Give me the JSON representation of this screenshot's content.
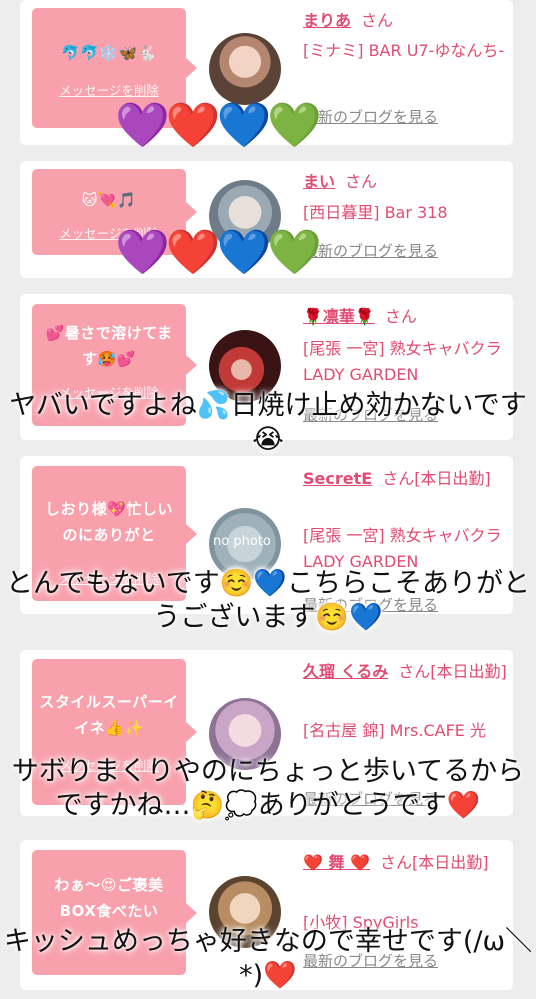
{
  "delete_label": "メッセージを削除",
  "blog_label": "最新のブログを見る",
  "san_label": "さん",
  "cards": [
    {
      "message": "🐬🐬❄️🦋🐇",
      "name": "まりあ",
      "honorific": "さん",
      "shop": "[ミナミ] BAR U7-ゆなんち-"
    },
    {
      "message": "🐱💘🎵",
      "name": "まい",
      "honorific": "さん",
      "shop": "[西日暮里] Bar 318"
    },
    {
      "message": "💕暑さで溶けてます🥵💕",
      "name": "🌹凛華🌹",
      "honorific": "さん",
      "shop": "[尾張 一宮] 熟女キャバクラ LADY GARDEN"
    },
    {
      "message": "しおり様💖忙しいのにありがと",
      "name": "SecretE",
      "honorific": "さん[本日出勤]",
      "shop": "[尾張 一宮] 熟女キャバクラ LADY GARDEN"
    },
    {
      "message": "スタイルスーパーイイネ👍✨",
      "name": "久瑠 くるみ",
      "honorific": "さん[本日出勤]",
      "shop": "[名古屋 錦] Mrs.CAFE 光"
    },
    {
      "message": "わぁ〜😍ご褒美BOX食べたい",
      "name": "❤️ 舞 ❤️",
      "honorific": "さん[本日出勤]",
      "shop": "[小牧] SpyGirls"
    }
  ],
  "hearts": "💜❤️💙💚",
  "avatar_placeholder": "no photo",
  "overlays": [
    "ヤバいですよね💦日焼け止め効かないです😭",
    "とんでもないです☺️💙こちらこそありがとうございます☺️💙",
    "サボりまくりやのにちょっと歩いてるからですかね…🤔💭ありがとうです❤️",
    "キッシュめっちゃ好きなので幸せです(/ω＼*)❤️"
  ],
  "colors": {
    "bubble": "#f8a1ad",
    "name": "#e24b73",
    "background": "#ededed"
  }
}
